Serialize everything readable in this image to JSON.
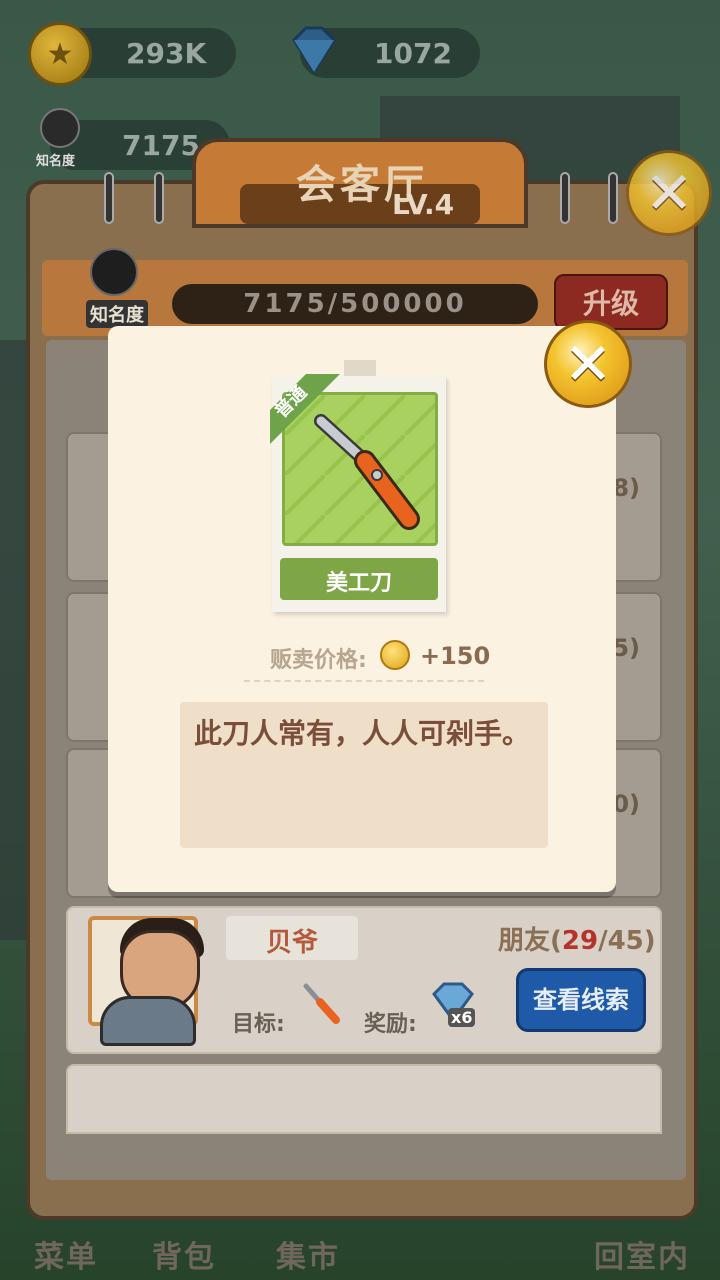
{
  "hud": {
    "coins": "293K",
    "diamonds": "1072",
    "fame_value": "7175",
    "fame_label": "知名度"
  },
  "hall": {
    "title": "会客厅",
    "level": "LV.4",
    "fame_label": "知名度",
    "progress": "7175/500000",
    "upgrade_label": "升级"
  },
  "hidden_cards": [
    {
      "count_suffix": "8)"
    },
    {
      "count_suffix": "5)"
    },
    {
      "count_suffix": "0)"
    }
  ],
  "npc": {
    "name": "贝爷",
    "relation_prefix": "朋友(",
    "relation_current": "29",
    "relation_suffix": "/45)",
    "target_label": "目标:",
    "reward_label": "奖励:",
    "reward_count": "x6",
    "clue_button": "查看线索",
    "target_icon": "utility-knife-icon",
    "reward_icon": "diamond-icon"
  },
  "popup": {
    "rarity": "普通",
    "item_name": "美工刀",
    "item_icon": "utility-knife-icon",
    "price_label": "贩卖价格:",
    "price_value": "+150",
    "description": "此刀人常有，人人可剁手。"
  },
  "bottom_nav": {
    "menu": "菜单",
    "bag": "背包",
    "market": "集市",
    "home": "回室内"
  },
  "colors": {
    "accent_orange": "#c57a35",
    "upgrade_red": "#8c2a22",
    "clue_blue": "#1e5aa8",
    "rarity_green": "#6fa34a",
    "relation_highlight": "#b4342a"
  }
}
